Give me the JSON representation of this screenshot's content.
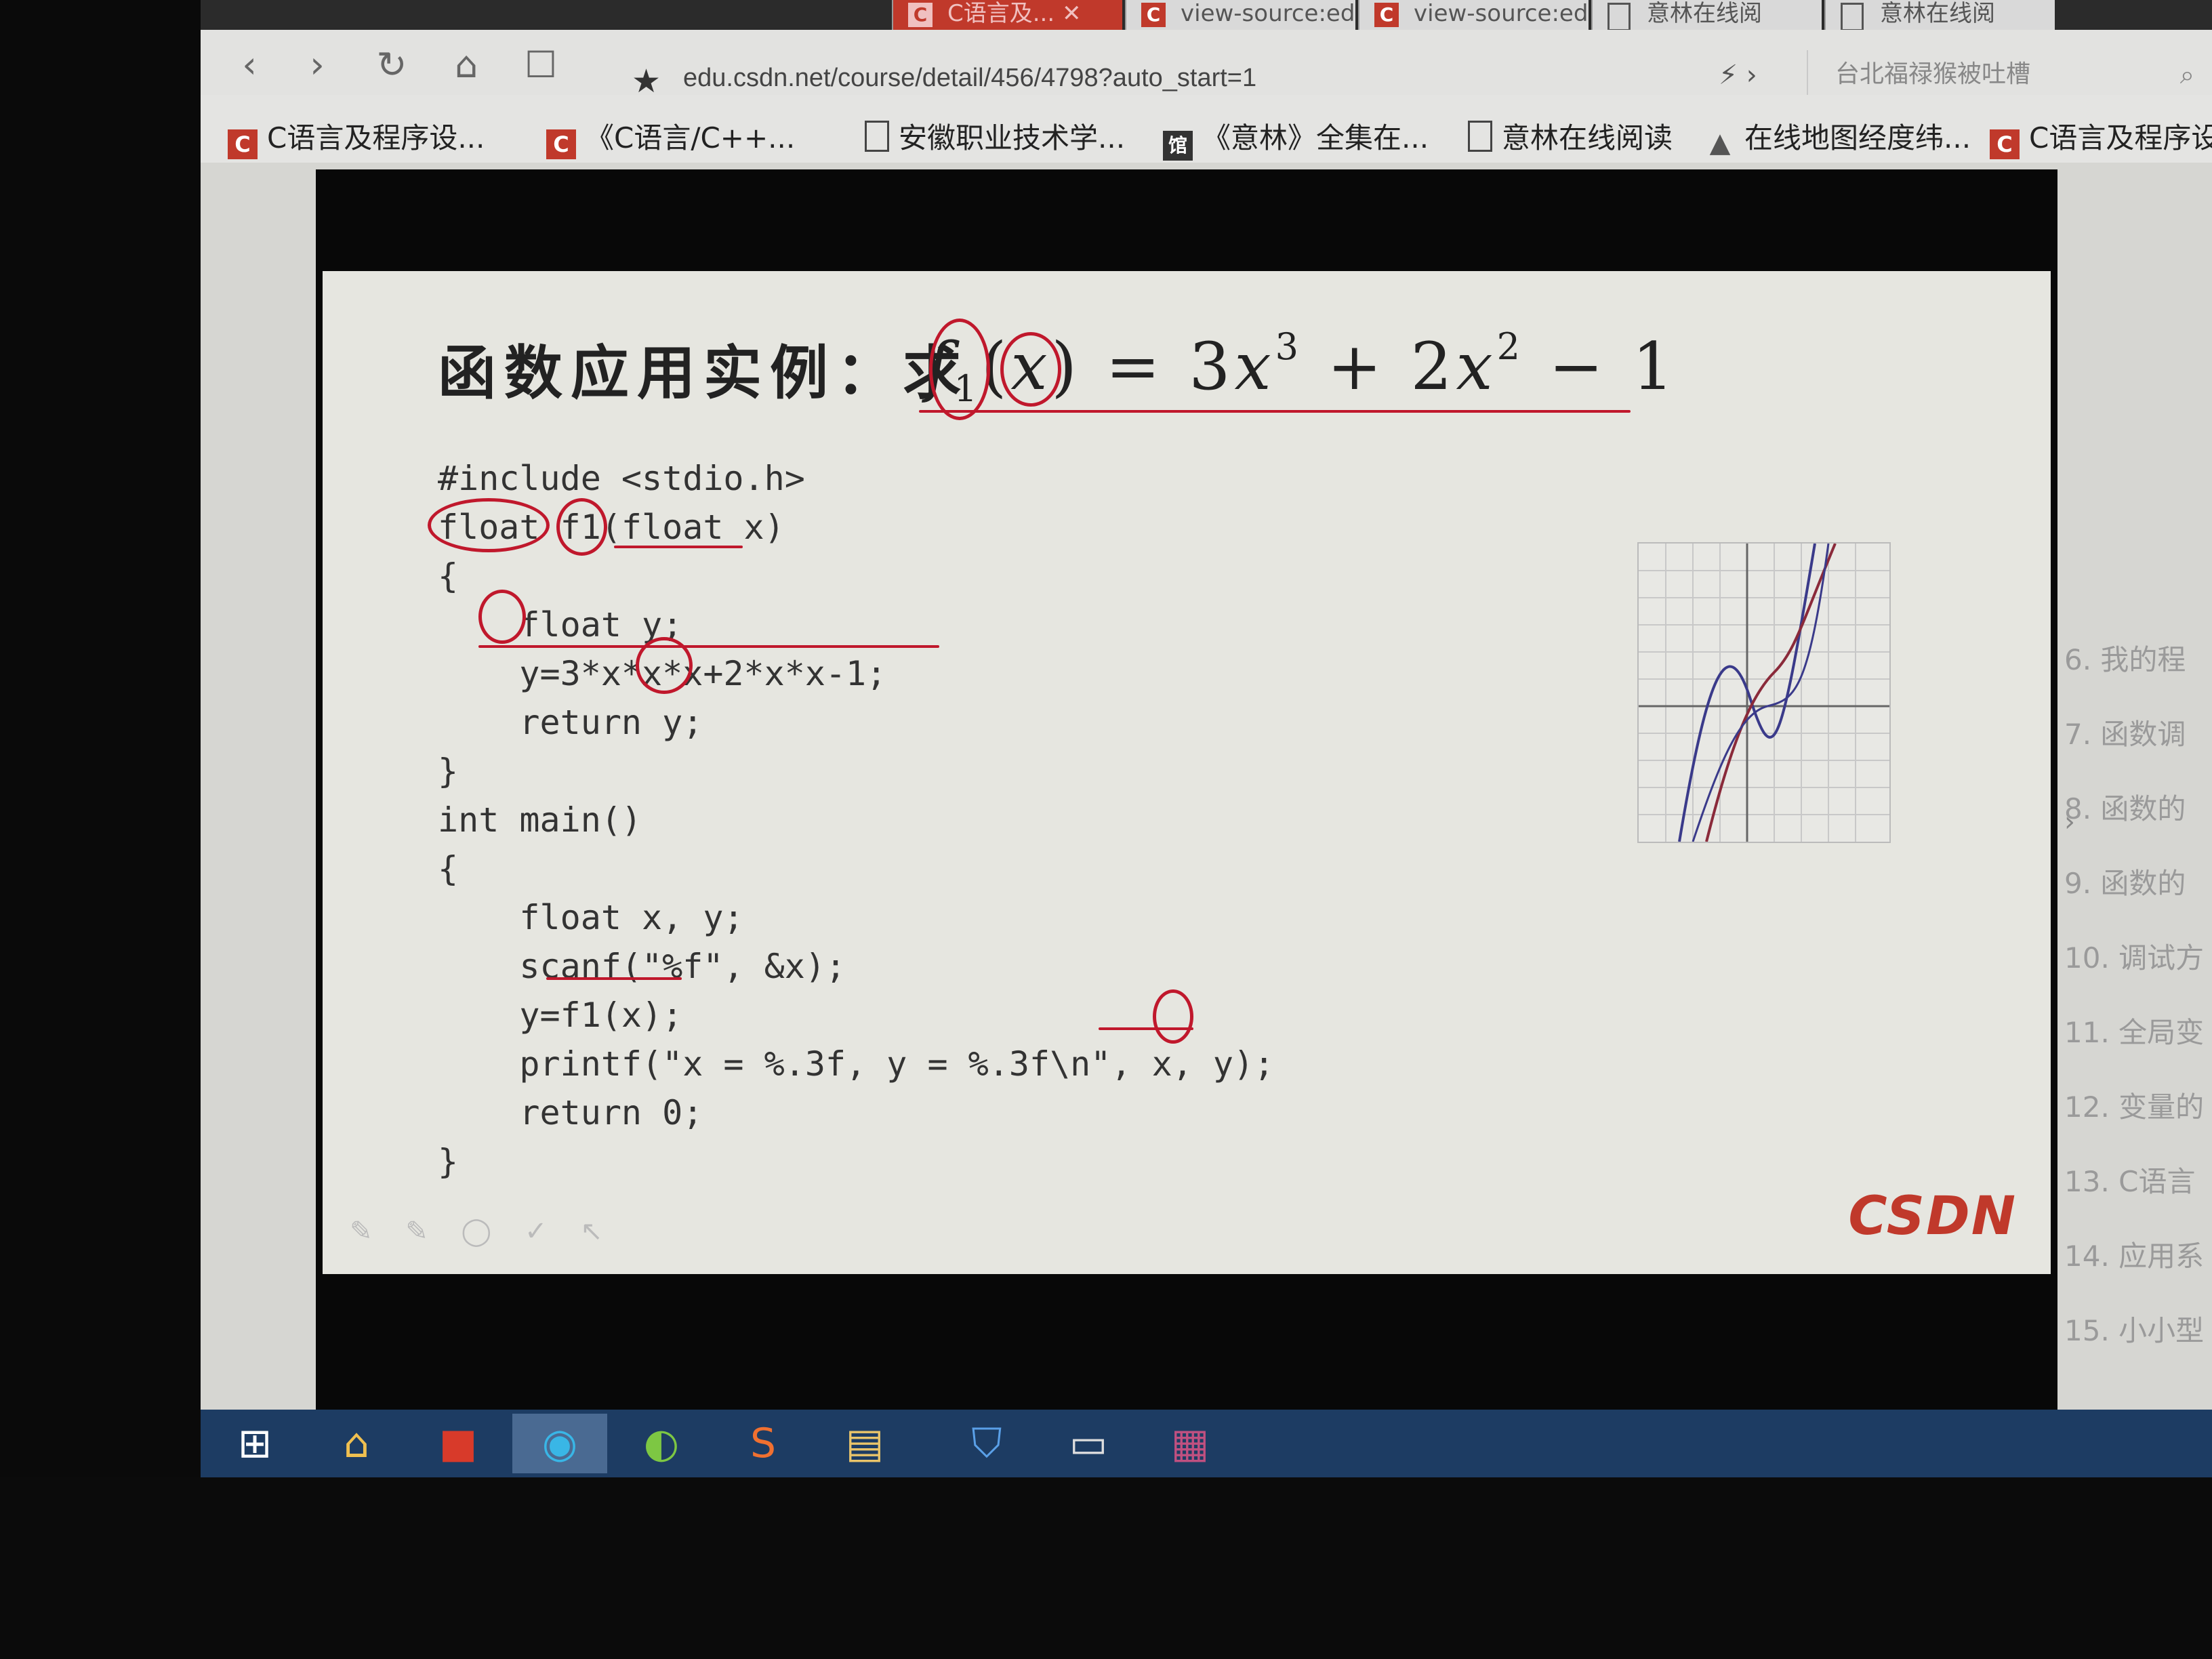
{
  "browser": {
    "tabs": [
      {
        "label": "C语言及... ✕"
      },
      {
        "label": "view-source:edu"
      },
      {
        "label": "view-source:edu"
      },
      {
        "label": "意林在线阅"
      },
      {
        "label": "意林在线阅"
      }
    ],
    "nav": {
      "back": "‹",
      "forward": "›",
      "reload": "↻",
      "home": "⌂",
      "reader": "☐"
    },
    "url": "edu.csdn.net/course/detail/456/4798?auto_start=1",
    "search_placeholder": "台北福禄猴被吐槽",
    "bookmarks": [
      {
        "label": "C语言及程序设...",
        "icon": "csdn-icon"
      },
      {
        "label": "《C语言/C++...",
        "icon": "csdn-icon"
      },
      {
        "label": "安徽职业技术学...",
        "icon": "page-icon"
      },
      {
        "label": "《意林》全集在...",
        "icon": "library-icon"
      },
      {
        "label": "意林在线阅读",
        "icon": "page-icon"
      },
      {
        "label": "在线地图经度纬...",
        "icon": "map-icon"
      },
      {
        "label": "C语言及程序设",
        "icon": "csdn-icon"
      }
    ]
  },
  "slide": {
    "heading": "函数应用实例：求",
    "formula": {
      "f": "f",
      "sub": "1",
      "x": "x",
      "rest1": " = 3",
      "x3": "x",
      "sup3": "3",
      "rest2": " + 2",
      "x2": "x",
      "sup2": "2",
      "rest3": " − 1"
    },
    "code": [
      "#include <stdio.h>",
      "float f1(float x)",
      "{",
      "    float y;",
      "    y=3*x*x*x+2*x*x-1;",
      "    return y;",
      "}",
      "int main()",
      "{",
      "    float x, y;",
      "    scanf(\"%f\", &x);",
      "    y=f1(x);",
      "    printf(\"x = %.3f, y = %.3f\\n\", x, y);",
      "    return 0;",
      "}"
    ],
    "logo": "CSDN"
  },
  "sidebar": {
    "items": [
      "6. 我的程",
      "7. 函数调",
      "8. 函数的",
      "9. 函数的",
      "10. 调试方",
      "11. 全局变",
      "12. 变量的",
      "13. C语言",
      "14. 应用系",
      "15. 小小型"
    ]
  },
  "taskbar": {
    "buttons": [
      "start-icon",
      "home-icon",
      "pdf-icon",
      "browser-icon",
      "ie-icon",
      "sogou-icon",
      "folder-icon",
      "shield-icon",
      "explorer-icon",
      "winrar-icon"
    ]
  },
  "colors": {
    "accent": "#c0182c",
    "code_blue": "#1f4fb0",
    "taskbar": "#1d3c63",
    "csdn_red": "#c0392b"
  }
}
